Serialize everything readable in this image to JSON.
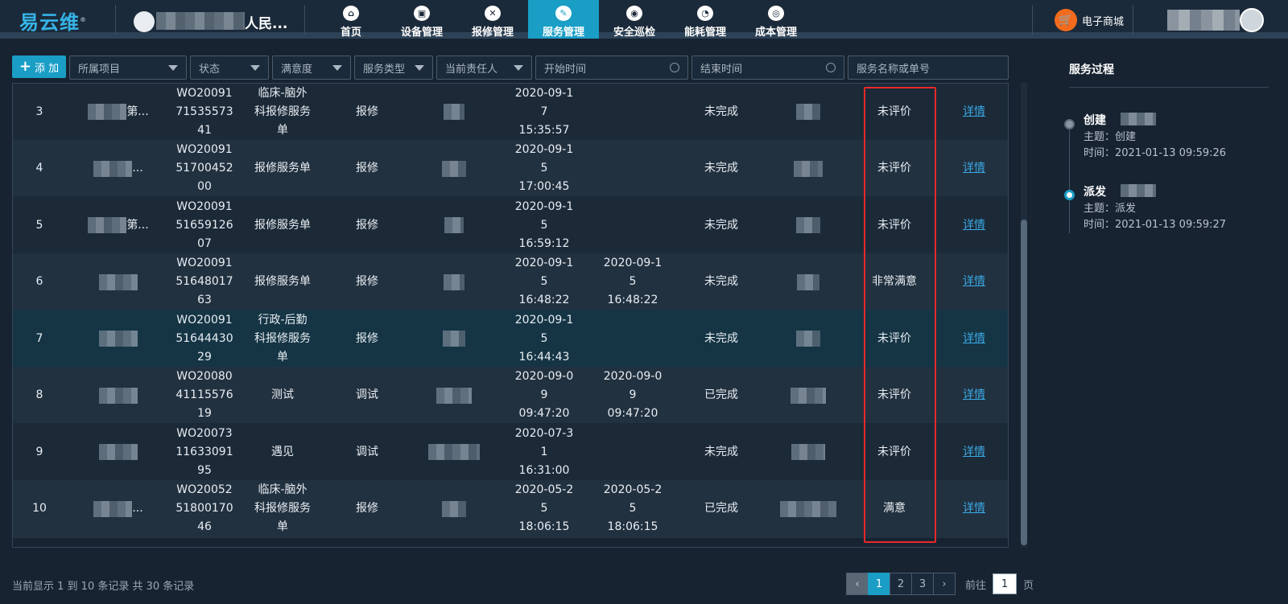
{
  "header": {
    "logo": "易云维",
    "logo_mark": "®",
    "org_name_suffix": "人民...",
    "nav": [
      {
        "label": "首页",
        "icon": "home-icon",
        "glyph": "⌂"
      },
      {
        "label": "设备管理",
        "icon": "device-icon",
        "glyph": "▣"
      },
      {
        "label": "报修管理",
        "icon": "repair-tools-icon",
        "glyph": "✕"
      },
      {
        "label": "服务管理",
        "icon": "edit-icon",
        "glyph": "✎",
        "active": true
      },
      {
        "label": "安全巡检",
        "icon": "location-icon",
        "glyph": "◉"
      },
      {
        "label": "能耗管理",
        "icon": "pie-chart-icon",
        "glyph": "◔"
      },
      {
        "label": "成本管理",
        "icon": "cost-icon",
        "glyph": "◎"
      }
    ],
    "mall_label": "电子商城"
  },
  "filters": {
    "add_label": "添 加",
    "project": "所属项目",
    "status": "状态",
    "satisfaction": "满意度",
    "service_type": "服务类型",
    "assignee": "当前责任人",
    "start_time": "开始时间",
    "end_time": "结束时间",
    "search_placeholder": "服务名称或单号"
  },
  "table": {
    "rows": [
      {
        "no": "3",
        "project_suffix": "第...",
        "order_no": "WO20091 71535573 41",
        "name": "临床-脑外 科报修服务 单",
        "type": "报修",
        "start": "2020-09-1 7 15:35:57",
        "end": "",
        "status": "未完成",
        "rating": "未评价",
        "action": "详情"
      },
      {
        "no": "4",
        "project_suffix": "...",
        "order_no": "WO20091 51700452 00",
        "name": "报修服务单",
        "type": "报修",
        "start": "2020-09-1 5 17:00:45",
        "end": "",
        "status": "未完成",
        "rating": "未评价",
        "action": "详情"
      },
      {
        "no": "5",
        "project_suffix": "第...",
        "order_no": "WO20091 51659126 07",
        "name": "报修服务单",
        "type": "报修",
        "start": "2020-09-1 5 16:59:12",
        "end": "",
        "status": "未完成",
        "rating": "未评价",
        "action": "详情"
      },
      {
        "no": "6",
        "project_suffix": "",
        "order_no": "WO20091 51648017 63",
        "name": "报修服务单",
        "type": "报修",
        "start": "2020-09-1 5 16:48:22",
        "end": "2020-09-1 5 16:48:22",
        "status": "未完成",
        "rating": "非常满意",
        "action": "详情"
      },
      {
        "no": "7",
        "project_suffix": "",
        "order_no": "WO20091 51644430 29",
        "name": "行政-后勤 科报修服务 单",
        "type": "报修",
        "start": "2020-09-1 5 16:44:43",
        "end": "",
        "status": "未完成",
        "rating": "未评价",
        "action": "详情"
      },
      {
        "no": "8",
        "project_suffix": "",
        "order_no": "WO20080 41115576 19",
        "name": "测试",
        "type": "调试",
        "start": "2020-09-0 9 09:47:20",
        "end": "2020-09-0 9 09:47:20",
        "status": "已完成",
        "rating": "未评价",
        "action": "详情"
      },
      {
        "no": "9",
        "project_suffix": "",
        "order_no": "WO20073 11633091 95",
        "name": "遇见",
        "type": "调试",
        "start": "2020-07-3 1 16:31:00",
        "end": "",
        "status": "未完成",
        "rating": "未评价",
        "action": "详情"
      },
      {
        "no": "10",
        "project_suffix": "...",
        "order_no": "WO20052 51800170 46",
        "name": "临床-脑外 科报修服务 单",
        "type": "报修",
        "start": "2020-05-2 5 18:06:15",
        "end": "2020-05-2 5 18:06:15",
        "status": "已完成",
        "rating": "满意",
        "action": "详情"
      }
    ]
  },
  "footer": {
    "info": "当前显示 1 到 10 条记录    共 30 条记录",
    "pages": [
      "1",
      "2",
      "3"
    ],
    "prev": "‹",
    "next": "›",
    "goto_prefix": "前往",
    "goto_value": "1",
    "goto_suffix": "页"
  },
  "side": {
    "title": "服务过程",
    "steps": [
      {
        "title": "创建",
        "subject": "主题：创建",
        "time": "时间：2021-01-13 09:59:26"
      },
      {
        "title": "派发",
        "subject": "主题：派发",
        "time": "时间：2021-01-13 09:59:27"
      }
    ]
  }
}
